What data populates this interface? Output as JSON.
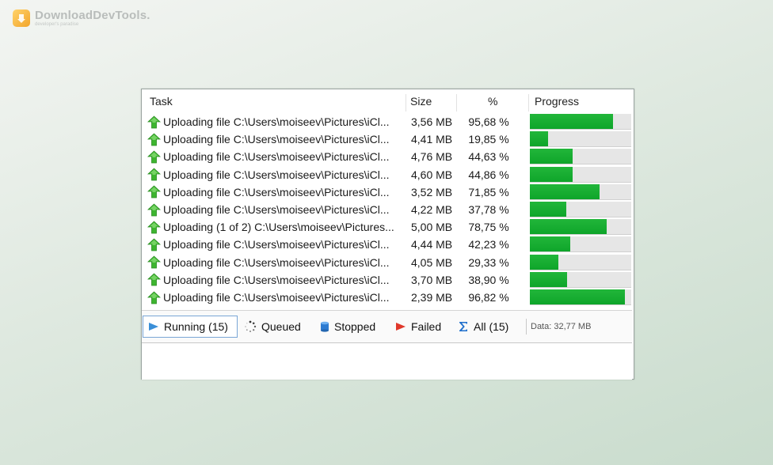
{
  "logo": {
    "title": "DownloadDevTools.",
    "subtitle": "developer's paradise"
  },
  "columns": {
    "task": "Task",
    "size": "Size",
    "percent": "%",
    "progress": "Progress"
  },
  "rows": [
    {
      "task": "Uploading file C:\\Users\\moiseev\\Pictures\\iCl...",
      "size": "3,56 MB",
      "percent": "95,68 %",
      "progress": 0.82
    },
    {
      "task": "Uploading file C:\\Users\\moiseev\\Pictures\\iCl...",
      "size": "4,41 MB",
      "percent": "19,85 %",
      "progress": 0.18
    },
    {
      "task": "Uploading file C:\\Users\\moiseev\\Pictures\\iCl...",
      "size": "4,76 MB",
      "percent": "44,63 %",
      "progress": 0.42
    },
    {
      "task": "Uploading file C:\\Users\\moiseev\\Pictures\\iCl...",
      "size": "4,60 MB",
      "percent": "44,86 %",
      "progress": 0.42
    },
    {
      "task": "Uploading file C:\\Users\\moiseev\\Pictures\\iCl...",
      "size": "3,52 MB",
      "percent": "71,85 %",
      "progress": 0.69
    },
    {
      "task": "Uploading file C:\\Users\\moiseev\\Pictures\\iCl...",
      "size": "4,22 MB",
      "percent": "37,78 %",
      "progress": 0.36
    },
    {
      "task": "Uploading (1 of 2) C:\\Users\\moiseev\\Pictures...",
      "size": "5,00 MB",
      "percent": "78,75 %",
      "progress": 0.76
    },
    {
      "task": "Uploading file C:\\Users\\moiseev\\Pictures\\iCl...",
      "size": "4,44 MB",
      "percent": "42,23 %",
      "progress": 0.4
    },
    {
      "task": "Uploading file C:\\Users\\moiseev\\Pictures\\iCl...",
      "size": "4,05 MB",
      "percent": "29,33 %",
      "progress": 0.28
    },
    {
      "task": "Uploading file C:\\Users\\moiseev\\Pictures\\iCl...",
      "size": "3,70 MB",
      "percent": "38,90 %",
      "progress": 0.37
    },
    {
      "task": "Uploading file C:\\Users\\moiseev\\Pictures\\iCl...",
      "size": "2,39 MB",
      "percent": "96,82 %",
      "progress": 0.94
    }
  ],
  "tabs": {
    "running": {
      "label": "Running (15)",
      "icon": "play-icon"
    },
    "queued": {
      "label": "Queued",
      "icon": "spinner-icon"
    },
    "stopped": {
      "label": "Stopped",
      "icon": "database-icon"
    },
    "failed": {
      "label": "Failed",
      "icon": "red-arrow-icon"
    },
    "all": {
      "label": "All (15)",
      "icon": "sigma-icon"
    }
  },
  "data_info": "Data: 32,77 MB",
  "colors": {
    "progress_fill": "#15ad30",
    "upload_arrow": "#3db52f",
    "active_tab_border": "#7aa6d6"
  }
}
